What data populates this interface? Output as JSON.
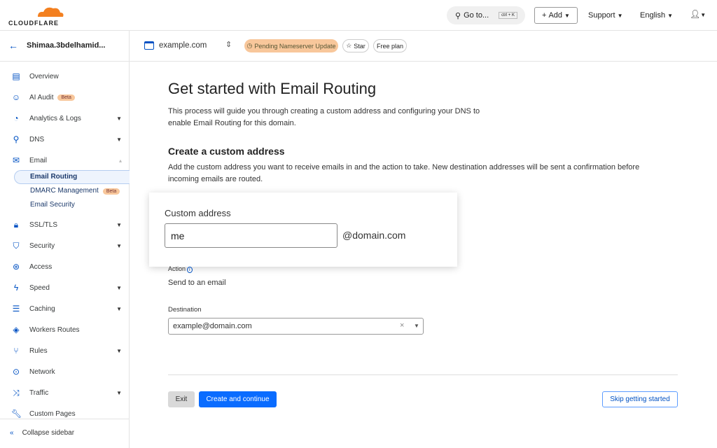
{
  "brand": {
    "name": "CLOUDFLARE",
    "color": "#f38020"
  },
  "topbar": {
    "search_label": "Go to...",
    "shortcut": "ctrl + K",
    "add_label": "Add",
    "support_label": "Support",
    "language_label": "English"
  },
  "subbar": {
    "account": "Shimaa.3bdelhamid...",
    "domain": "example.com",
    "status_badge": "Pending Nameserver Update",
    "star_label": "Star",
    "plan_label": "Free plan"
  },
  "sidebar": {
    "items": [
      {
        "label": "Overview",
        "icon": "clipboard-icon"
      },
      {
        "label": "AI Audit",
        "icon": "robot-icon",
        "badge": "Beta"
      },
      {
        "label": "Analytics & Logs",
        "icon": "pie-chart-icon"
      },
      {
        "label": "DNS",
        "icon": "network-tree-icon"
      },
      {
        "label": "Email",
        "icon": "envelope-icon"
      },
      {
        "label": "SSL/TLS",
        "icon": "lock-icon"
      },
      {
        "label": "Security",
        "icon": "shield-icon"
      },
      {
        "label": "Access",
        "icon": "access-icon"
      },
      {
        "label": "Speed",
        "icon": "bolt-icon"
      },
      {
        "label": "Caching",
        "icon": "database-icon"
      },
      {
        "label": "Workers Routes",
        "icon": "workers-icon"
      },
      {
        "label": "Rules",
        "icon": "fork-icon"
      },
      {
        "label": "Network",
        "icon": "pin-icon"
      },
      {
        "label": "Traffic",
        "icon": "traffic-icon"
      },
      {
        "label": "Custom Pages",
        "icon": "wrench-icon"
      }
    ],
    "email_sub": [
      {
        "label": "Email Routing"
      },
      {
        "label": "DMARC Management",
        "badge": "Beta"
      },
      {
        "label": "Email Security"
      }
    ],
    "collapse_label": "Collapse sidebar"
  },
  "main": {
    "title": "Get started with Email Routing",
    "intro": "This process will guide you through creating a custom address and configuring your DNS to enable Email Routing for this domain.",
    "section_title": "Create a custom address",
    "section_desc": "Add the custom address you want to receive emails in and the action to take. New destination addresses will be sent a confirmation before incoming emails are routed.",
    "custom_address_label": "Custom address",
    "custom_address_value": "me",
    "domain_suffix": "@domain.com",
    "action_label": "Action",
    "action_value": "Send to an email",
    "destination_label": "Destination",
    "destination_value": "example@domain.com",
    "exit_label": "Exit",
    "create_label": "Create and continue",
    "skip_label": "Skip getting started"
  },
  "colors": {
    "primary": "#0051c3",
    "button_blue": "#0a6cff",
    "badge_orange": "#f8c79b"
  }
}
